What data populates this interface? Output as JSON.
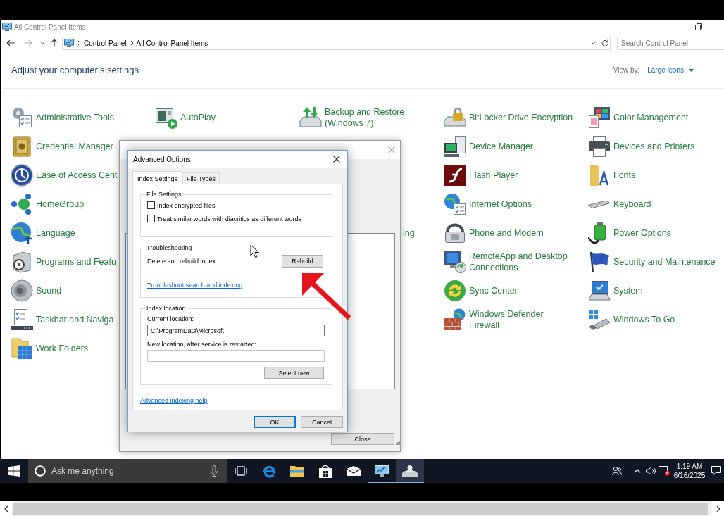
{
  "control_panel": {
    "title": "All Control Panel Items",
    "address_bar": {
      "breadcrumbs": [
        "Control Panel",
        "All Control Panel Items"
      ]
    },
    "search": {
      "placeholder": "Search Control Panel"
    },
    "heading": "Adjust your computer’s settings",
    "view_by": {
      "label": "View by:",
      "value": "Large icons"
    },
    "grid_rows": [
      {
        "cells": [
          {
            "label": "Administrative Tools",
            "kind": "full"
          },
          {
            "label": "AutoPlay",
            "kind": "full"
          },
          {
            "label": "Backup and Restore (Windows 7)",
            "kind": "full"
          },
          {
            "label": "BitLocker Drive Encryption",
            "kind": "full"
          },
          {
            "label": "Color Management",
            "kind": "full"
          }
        ]
      },
      {
        "cells": [
          {
            "label": "Credential Manager",
            "kind": "full"
          },
          {
            "kind": "hidden"
          },
          {
            "kind": "hidden"
          },
          {
            "label": "Device Manager",
            "kind": "full"
          },
          {
            "label": "Devices and Printers",
            "kind": "full"
          }
        ]
      },
      {
        "cells": [
          {
            "label": "Ease of Access Cent",
            "kind": "cut"
          },
          {
            "kind": "hidden"
          },
          {
            "kind": "hidden"
          },
          {
            "label": "Flash Player",
            "kind": "full"
          },
          {
            "label": "Fonts",
            "kind": "full"
          }
        ]
      },
      {
        "cells": [
          {
            "label": "HomeGroup",
            "kind": "full"
          },
          {
            "kind": "hidden"
          },
          {
            "kind": "hidden"
          },
          {
            "label": "Internet Options",
            "kind": "full"
          },
          {
            "label": "Keyboard",
            "kind": "full"
          }
        ]
      },
      {
        "cells": [
          {
            "label": "Language",
            "kind": "full"
          },
          {
            "kind": "hidden"
          },
          {
            "label": "ing",
            "kind": "tail"
          },
          {
            "label": "Phone and Modem",
            "kind": "full"
          },
          {
            "label": "Power Options",
            "kind": "full"
          }
        ]
      },
      {
        "cells": [
          {
            "label": "Programs and Featu",
            "kind": "cut"
          },
          {
            "kind": "hidden"
          },
          {
            "kind": "hidden"
          },
          {
            "label": "RemoteApp and Desktop Connections",
            "kind": "full"
          },
          {
            "label": "Security and Maintenance",
            "kind": "full"
          }
        ]
      },
      {
        "cells": [
          {
            "label": "Sound",
            "kind": "full"
          },
          {
            "kind": "hidden"
          },
          {
            "kind": "hidden"
          },
          {
            "label": "Sync Center",
            "kind": "full"
          },
          {
            "label": "System",
            "kind": "full"
          }
        ]
      },
      {
        "cells": [
          {
            "label": "Taskbar and Naviga",
            "kind": "cut"
          },
          {
            "kind": "hidden"
          },
          {
            "kind": "hidden"
          },
          {
            "label": "Windows Defender Firewall",
            "kind": "full"
          },
          {
            "label": "Windows To Go",
            "kind": "full"
          }
        ]
      },
      {
        "cells": [
          {
            "label": "Work Folders",
            "kind": "full"
          },
          {
            "kind": "hidden"
          },
          {
            "kind": "hidden"
          }
        ]
      }
    ]
  },
  "background_window": {
    "close_button": "Close"
  },
  "advanced_options": {
    "title": "Advanced Options",
    "tabs": [
      {
        "label": "Index Settings",
        "selected": true
      },
      {
        "label": "File Types",
        "selected": false
      }
    ],
    "file_settings": {
      "title": "File Settings",
      "options": [
        {
          "label": "Index encrypted files",
          "checked": false
        },
        {
          "label": "Treat similar words with diacritics as different words",
          "checked": false
        }
      ]
    },
    "troubleshooting": {
      "title": "Troubleshooting",
      "label": "Delete and rebuild index",
      "button": "Rebuild",
      "link": "Troubleshoot search and indexing"
    },
    "index_location": {
      "title": "Index location",
      "current_label": "Current location:",
      "current_value": "C:\\ProgramData\\Microsoft",
      "new_label": "New location, after service is restarted:",
      "button": "Select new"
    },
    "help_link": "Advanced indexing help",
    "buttons": [
      {
        "label": "OK",
        "default": true
      },
      {
        "label": "Cancel",
        "default": false
      }
    ]
  },
  "taskbar": {
    "search": {
      "placeholder": "Ask me anything"
    },
    "apps": [
      {
        "running": false,
        "selected": false
      },
      {
        "running": false,
        "selected": false
      },
      {
        "running": false,
        "selected": false
      },
      {
        "running": false,
        "selected": false
      },
      {
        "running": true,
        "selected": false
      },
      {
        "running": true,
        "selected": true
      }
    ],
    "clock": {
      "time": "1:19 AM",
      "date": "6/16/2025"
    }
  }
}
